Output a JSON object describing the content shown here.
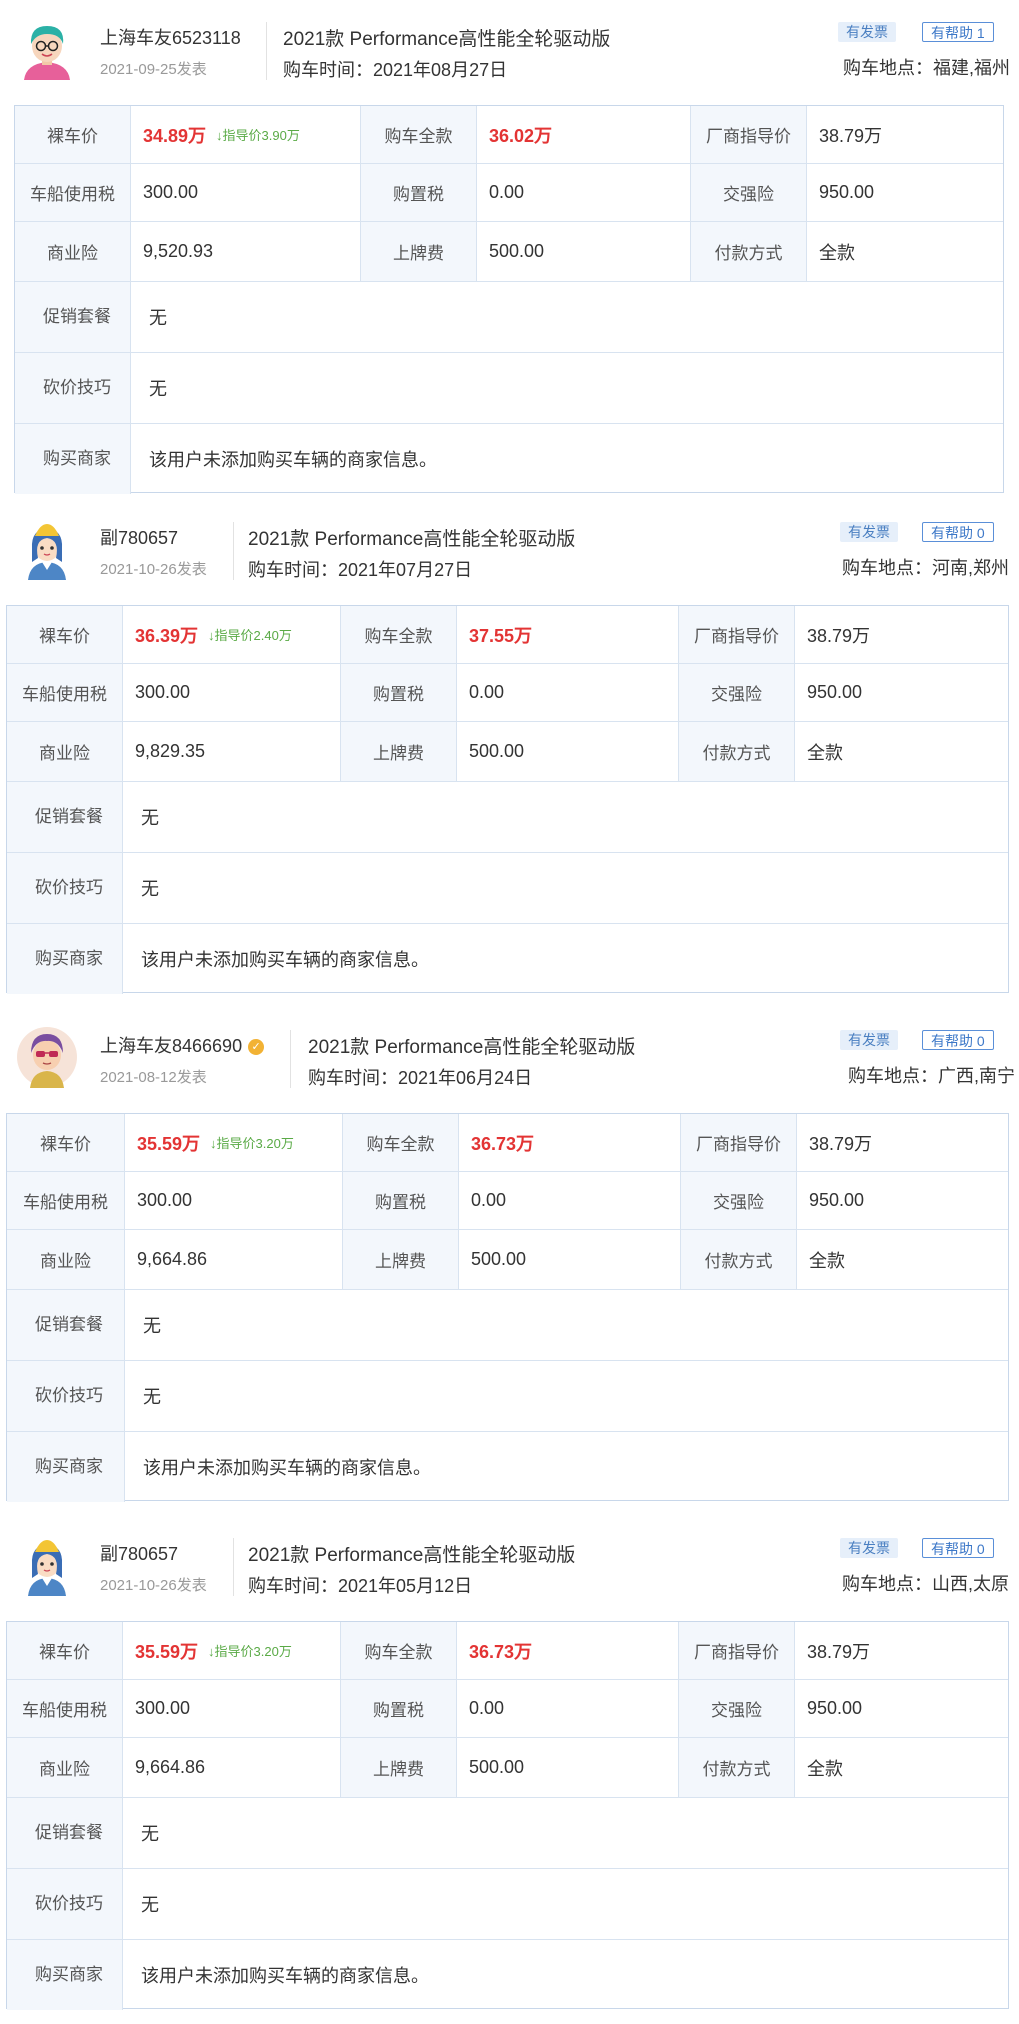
{
  "colors": {
    "price_red": "#e33434",
    "hint_green": "#5aaa46",
    "label_bg": "#f3f7fc",
    "border": "#d8e3f0"
  },
  "labels": {
    "bare_price": "裸车价",
    "total_price": "购车全款",
    "msrp": "厂商指导价",
    "vehicle_tax": "车船使用税",
    "purchase_tax": "购置税",
    "compulsory_ins": "交强险",
    "commercial_ins": "商业险",
    "plate_fee": "上牌费",
    "payment": "付款方式",
    "promo": "促销套餐",
    "bargain": "砍价技巧",
    "dealer": "购买商家"
  },
  "posts": [
    {
      "avatar_icon": "boy-avatar-icon",
      "user": "上海车友6523118",
      "verified": false,
      "date": "2021-09-25发表",
      "model": "2021款 Performance高性能全轮驱动版",
      "buy_time": "购车时间：2021年08月27日",
      "invoice_badge": "有发票",
      "help_badge": "有帮助 1",
      "location": "购车地点：福建,福州",
      "bare_price": "34.89万",
      "discount": "↓指导价3.90万",
      "total_price": "36.02万",
      "msrp": "38.79万",
      "vehicle_tax": "300.00",
      "purchase_tax": "0.00",
      "compulsory_ins": "950.00",
      "commercial_ins": "9,520.93",
      "plate_fee": "500.00",
      "payment": "全款",
      "promo": "无",
      "bargain": "无",
      "dealer": "该用户未添加购买车辆的商家信息。"
    },
    {
      "avatar_icon": "girl-avatar-icon",
      "user": "副780657",
      "verified": false,
      "date": "2021-10-26发表",
      "model": "2021款 Performance高性能全轮驱动版",
      "buy_time": "购车时间：2021年07月27日",
      "invoice_badge": "有发票",
      "help_badge": "有帮助 0",
      "location": "购车地点：河南,郑州",
      "bare_price": "36.39万",
      "discount": "↓指导价2.40万",
      "total_price": "37.55万",
      "msrp": "38.79万",
      "vehicle_tax": "300.00",
      "purchase_tax": "0.00",
      "compulsory_ins": "950.00",
      "commercial_ins": "9,829.35",
      "plate_fee": "500.00",
      "payment": "全款",
      "promo": "无",
      "bargain": "无",
      "dealer": "该用户未添加购买车辆的商家信息。"
    },
    {
      "avatar_icon": "sunglasses-avatar-icon",
      "user": "上海车友8466690",
      "verified": true,
      "date": "2021-08-12发表",
      "model": "2021款 Performance高性能全轮驱动版",
      "buy_time": "购车时间：2021年06月24日",
      "invoice_badge": "有发票",
      "help_badge": "有帮助 0",
      "location": "购车地点：广西,南宁",
      "bare_price": "35.59万",
      "discount": "↓指导价3.20万",
      "total_price": "36.73万",
      "msrp": "38.79万",
      "vehicle_tax": "300.00",
      "purchase_tax": "0.00",
      "compulsory_ins": "950.00",
      "commercial_ins": "9,664.86",
      "plate_fee": "500.00",
      "payment": "全款",
      "promo": "无",
      "bargain": "无",
      "dealer": "该用户未添加购买车辆的商家信息。"
    },
    {
      "avatar_icon": "girl-avatar-icon",
      "user": "副780657",
      "verified": false,
      "date": "2021-10-26发表",
      "model": "2021款 Performance高性能全轮驱动版",
      "buy_time": "购车时间：2021年05月12日",
      "invoice_badge": "有发票",
      "help_badge": "有帮助 0",
      "location": "购车地点：山西,太原",
      "bare_price": "35.59万",
      "discount": "↓指导价3.20万",
      "total_price": "36.73万",
      "msrp": "38.79万",
      "vehicle_tax": "300.00",
      "purchase_tax": "0.00",
      "compulsory_ins": "950.00",
      "commercial_ins": "9,664.86",
      "plate_fee": "500.00",
      "payment": "全款",
      "promo": "无",
      "bargain": "无",
      "dealer": "该用户未添加购买车辆的商家信息。"
    }
  ]
}
